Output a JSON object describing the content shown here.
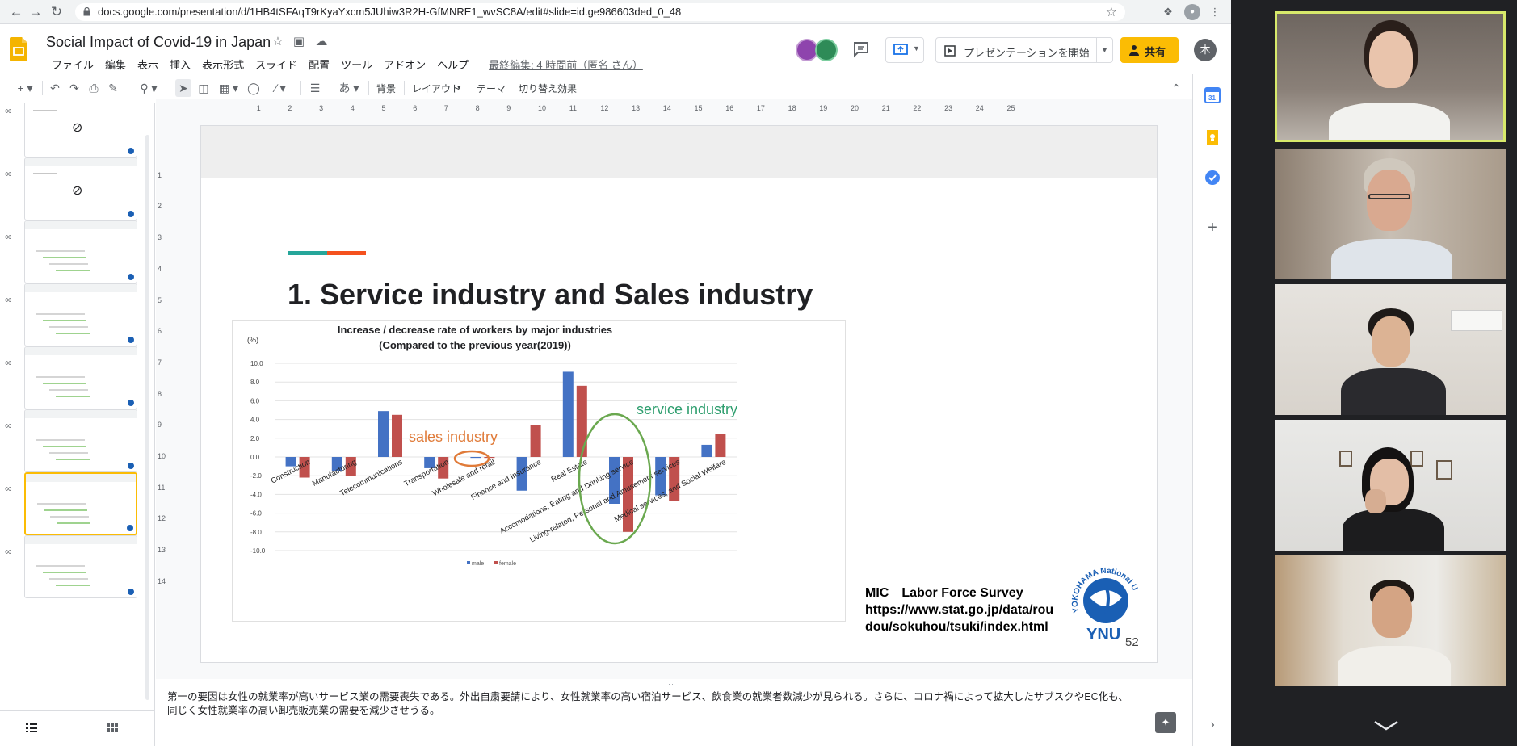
{
  "browser": {
    "url": "docs.google.com/presentation/d/1HB4tSFAqT9rKyaYxcm5JUhiw3R2H-GfMNRE1_wvSC8A/edit#slide=id.ge986603ded_0_48"
  },
  "docs": {
    "title": "Social Impact of Covid-19  in Japan",
    "menu": [
      "ファイル",
      "編集",
      "表示",
      "挿入",
      "表示形式",
      "スライド",
      "配置",
      "ツール",
      "アドオン",
      "ヘルプ"
    ],
    "last_edit": "最終編集: 4 時間前（匿名 さん）",
    "present_label": "プレゼンテーションを開始",
    "share_label": "共有",
    "user_initial": "木"
  },
  "toolbar": {
    "background": "背景",
    "layout": "レイアウト",
    "theme": "テーマ",
    "transition": "切り替え効果"
  },
  "filmstrip": {
    "slides": [
      {
        "num": "46",
        "title": "",
        "hidden": true
      },
      {
        "num": "47",
        "title": "",
        "hidden": true
      },
      {
        "num": "48",
        "title": "Social Impact of Covid-19 in Japan overview",
        "hidden": false
      },
      {
        "num": "49",
        "title": "How to analyze the social impact of Covid-19",
        "hidden": false
      },
      {
        "num": "50",
        "title": "The Current State of Elderly Care in Japan",
        "hidden": false
      },
      {
        "num": "51",
        "title": "Resident Dec",
        "hidden": false
      },
      {
        "num": "52",
        "title": "1. Service industry and Sales industry",
        "hidden": false
      },
      {
        "num": "53",
        "title": "Fear to COVID-19",
        "hidden": false
      }
    ]
  },
  "slide": {
    "title": "1. Service industry and Sales industry",
    "source_lines": [
      "MIC　Labor Force Survey",
      "https://www.stat.go.jp/data/rou",
      "dou/sokuhou/tsuki/index.html"
    ],
    "logo_ring": "YOKOHAMA National University",
    "logo_text": "YNU",
    "number": "52",
    "annotation_sales": "sales industry",
    "annotation_service": "service industry"
  },
  "chart_data": {
    "type": "bar",
    "title_lines": [
      "Increase / decrease rate of workers by major industries",
      "(Compared to the previous year(2019))"
    ],
    "ylabel": "(%)",
    "ylim": [
      -10,
      10
    ],
    "yticks": [
      "10.0",
      "8.0",
      "6.0",
      "4.0",
      "2.0",
      "0.0",
      "-2.0",
      "-4.0",
      "-6.0",
      "-8.0",
      "-10.0"
    ],
    "categories": [
      "Construction",
      "Manufacturing",
      "Telecommunications",
      "Transportation",
      "Wholesale and retail",
      "Finance and Insurance",
      "Real Estate",
      "Accomodations, Eating and Drinking service",
      "Living-related, Personal and Amusement services",
      "Medical services, and Social Welfare"
    ],
    "series": [
      {
        "name": "male",
        "color": "#4472c4",
        "values": [
          -1.0,
          -1.5,
          4.9,
          -1.2,
          -0.1,
          -3.6,
          9.1,
          -5.0,
          -4.1,
          1.3
        ]
      },
      {
        "name": "female",
        "color": "#c0504d",
        "values": [
          -2.2,
          -2.0,
          4.5,
          -2.3,
          -0.1,
          3.4,
          7.6,
          -8.0,
          -4.7,
          2.5
        ]
      }
    ],
    "legend": "bottom",
    "grid": true
  },
  "notes": {
    "text": "第一の要因は女性の就業率が高いサービス業の需要喪失である。外出自粛要請により、女性就業率の高い宿泊サービス、飲食業の就業者数減少が見られる。さらに、コロナ禍によって拡大したサブスクやEC化も、同じく女性就業率の高い卸売販売業の需要を減少させうる。"
  },
  "colors": {
    "accent": "#fbbc04",
    "teal": "#26a69a",
    "orange": "#f4511e",
    "annotation_orange": "#e07b39",
    "annotation_green": "#2e9e6e"
  }
}
